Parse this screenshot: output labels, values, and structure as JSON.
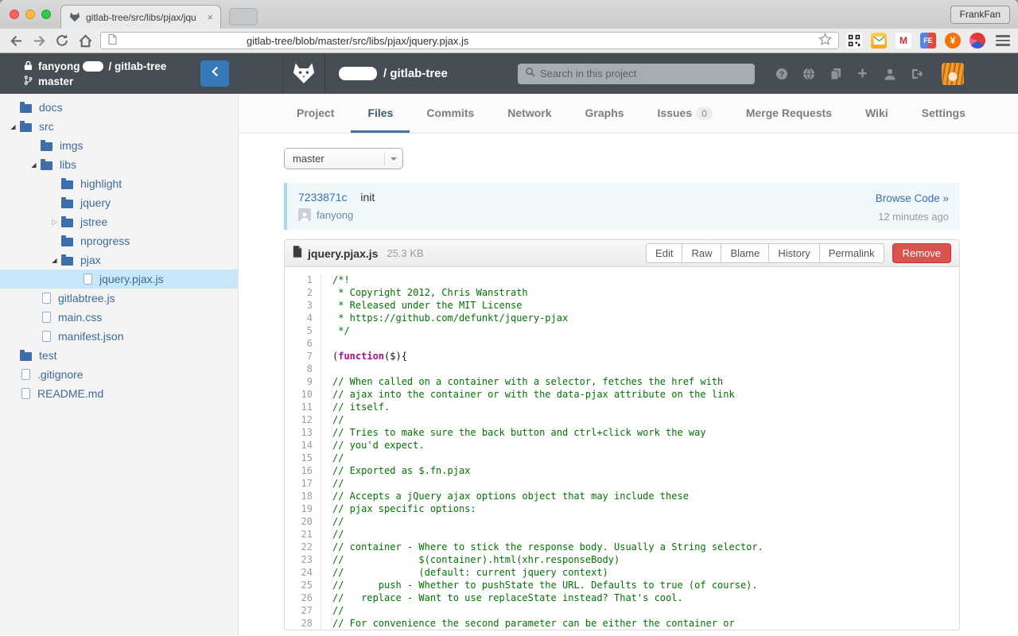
{
  "browser": {
    "tab_title": "gitlab-tree/src/libs/pjax/jqu",
    "tab_close": "×",
    "profile_name": "FrankFan",
    "url_visible": "gitlab-tree/blob/master/src/libs/pjax/jquery.pjax.js",
    "nav_icons": [
      "back-icon",
      "forward-icon",
      "reload-icon",
      "home-icon"
    ],
    "extensions": [
      {
        "name": "qr-code-icon",
        "kind": "qr"
      },
      {
        "name": "mail-icon",
        "kind": "mail"
      },
      {
        "name": "gmail-icon",
        "kind": "gmail",
        "glyph": "M"
      },
      {
        "name": "fe-icon",
        "kind": "fe",
        "glyph": "FE"
      },
      {
        "name": "hui-icon",
        "kind": "hui",
        "glyph": "¥"
      },
      {
        "name": "pie-icon",
        "kind": "pie",
        "glyph": ""
      }
    ]
  },
  "header": {
    "project_title": "/ gitlab-tree",
    "search_placeholder": "Search in this project",
    "icons": [
      "help-icon",
      "globe-icon",
      "copy-icon",
      "plus-icon",
      "profile-icon",
      "signout-icon"
    ]
  },
  "sidebar_head": {
    "repo_owner": "fanyong",
    "repo_suffix": "/ gitlab-tree",
    "branch": "master"
  },
  "nav": {
    "tabs": [
      {
        "label": "Project"
      },
      {
        "label": "Files",
        "active": true
      },
      {
        "label": "Commits"
      },
      {
        "label": "Network"
      },
      {
        "label": "Graphs"
      },
      {
        "label": "Issues",
        "badge": "0"
      },
      {
        "label": "Merge Requests"
      },
      {
        "label": "Wiki"
      },
      {
        "label": "Settings"
      }
    ]
  },
  "tree": [
    {
      "label": "docs",
      "type": "folder",
      "level": 0,
      "toggle": "none"
    },
    {
      "label": "src",
      "type": "folder",
      "level": 0,
      "toggle": "open"
    },
    {
      "label": "imgs",
      "type": "folder",
      "level": 1,
      "toggle": "none"
    },
    {
      "label": "libs",
      "type": "folder",
      "level": 1,
      "toggle": "open"
    },
    {
      "label": "highlight",
      "type": "folder",
      "level": 2,
      "toggle": "none"
    },
    {
      "label": "jquery",
      "type": "folder",
      "level": 2,
      "toggle": "none"
    },
    {
      "label": "jstree",
      "type": "folder",
      "level": 2,
      "toggle": "closed"
    },
    {
      "label": "nprogress",
      "type": "folder",
      "level": 2,
      "toggle": "none"
    },
    {
      "label": "pjax",
      "type": "folder",
      "level": 2,
      "toggle": "open"
    },
    {
      "label": "jquery.pjax.js",
      "type": "file",
      "level": 3,
      "toggle": "none",
      "selected": true
    },
    {
      "label": "gitlabtree.js",
      "type": "file",
      "level": 1,
      "toggle": "none"
    },
    {
      "label": "main.css",
      "type": "file",
      "level": 1,
      "toggle": "none"
    },
    {
      "label": "manifest.json",
      "type": "file",
      "level": 1,
      "toggle": "none"
    },
    {
      "label": "test",
      "type": "folder",
      "level": 0,
      "toggle": "none"
    },
    {
      "label": ".gitignore",
      "type": "file",
      "level": 0,
      "toggle": "none"
    },
    {
      "label": "README.md",
      "type": "file",
      "level": 0,
      "toggle": "none"
    }
  ],
  "content": {
    "branch_selected": "master",
    "commit": {
      "sha": "7233871c",
      "message": "init",
      "author": "fanyong",
      "browse_link": "Browse Code »",
      "time": "12 minutes ago"
    }
  },
  "file": {
    "name": "jquery.pjax.js",
    "size": "25.3 KB",
    "actions": [
      "Edit",
      "Raw",
      "Blame",
      "History",
      "Permalink"
    ],
    "remove_label": "Remove"
  },
  "code": {
    "lines": [
      {
        "c": "cm",
        "t": "/*!"
      },
      {
        "c": "cm",
        "t": " * Copyright 2012, Chris Wanstrath"
      },
      {
        "c": "cm",
        "t": " * Released under the MIT License"
      },
      {
        "c": "cm",
        "t": " * https://github.com/defunkt/jquery-pjax"
      },
      {
        "c": "cm",
        "t": " */"
      },
      {
        "t": ""
      },
      {
        "parts": [
          {
            "t": "("
          },
          {
            "c": "kw",
            "t": "function"
          },
          {
            "t": "($){"
          }
        ]
      },
      {
        "t": ""
      },
      {
        "c": "cm",
        "t": "// When called on a container with a selector, fetches the href with"
      },
      {
        "c": "cm",
        "t": "// ajax into the container or with the data-pjax attribute on the link"
      },
      {
        "c": "cm",
        "t": "// itself."
      },
      {
        "c": "cm",
        "t": "//"
      },
      {
        "c": "cm",
        "t": "// Tries to make sure the back button and ctrl+click work the way"
      },
      {
        "c": "cm",
        "t": "// you'd expect."
      },
      {
        "c": "cm",
        "t": "//"
      },
      {
        "c": "cm",
        "t": "// Exported as $.fn.pjax"
      },
      {
        "c": "cm",
        "t": "//"
      },
      {
        "c": "cm",
        "t": "// Accepts a jQuery ajax options object that may include these"
      },
      {
        "c": "cm",
        "t": "// pjax specific options:"
      },
      {
        "c": "cm",
        "t": "//"
      },
      {
        "c": "cm",
        "t": "//"
      },
      {
        "c": "cm",
        "t": "// container - Where to stick the response body. Usually a String selector."
      },
      {
        "c": "cm",
        "t": "//             $(container).html(xhr.responseBody)"
      },
      {
        "c": "cm",
        "t": "//             (default: current jquery context)"
      },
      {
        "c": "cm",
        "t": "//      push - Whether to pushState the URL. Defaults to true (of course)."
      },
      {
        "c": "cm",
        "t": "//   replace - Want to use replaceState instead? That's cool."
      },
      {
        "c": "cm",
        "t": "//"
      },
      {
        "c": "cm",
        "t": "// For convenience the second parameter can be either the container or"
      }
    ]
  },
  "colors": {
    "header_bg": "#474d54",
    "accent_blue": "#4273a2",
    "tree_link": "#3d6a99",
    "selected_row": "#c8e7f9",
    "remove_red": "#d9534f",
    "comment_green": "#007400",
    "keyword_magenta": "#aa0d91",
    "commit_box_border": "#a8d8ea"
  }
}
